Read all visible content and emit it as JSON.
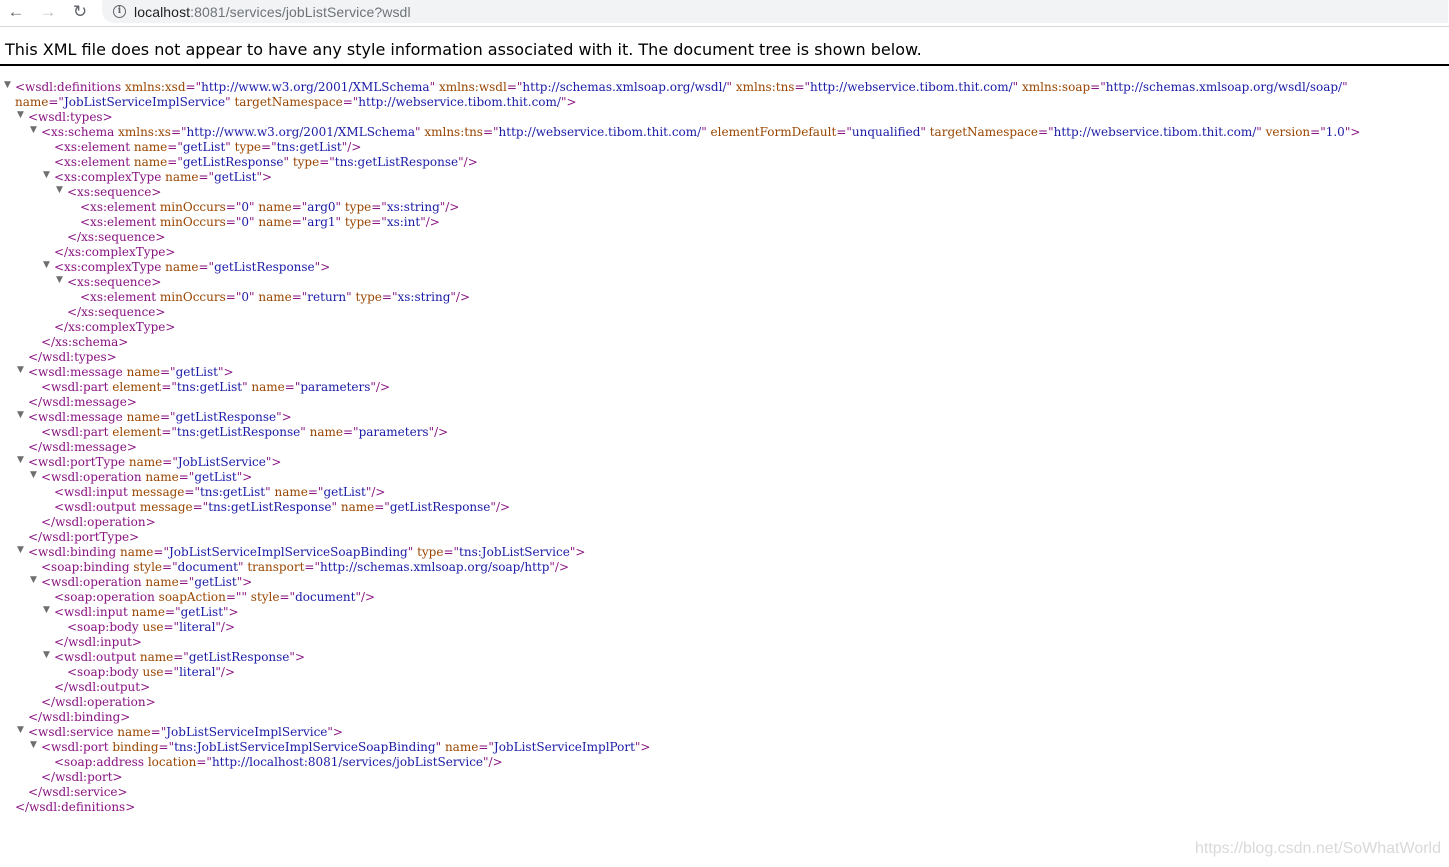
{
  "browser": {
    "url_host": "localhost",
    "url_rest": ":8081/services/jobListService?wsdl"
  },
  "banner": {
    "text": "This XML file does not appear to have any style information associated with it. The document tree is shown below."
  },
  "xml_lines": [
    {
      "indent": 0,
      "toggle": true,
      "parts": [
        [
          "t",
          "<wsdl:definitions "
        ],
        [
          "an",
          "xmlns:xsd"
        ],
        [
          "t",
          "=\""
        ],
        [
          "av",
          "http://www.w3.org/2001/XMLSchema"
        ],
        [
          "t",
          "\" "
        ],
        [
          "an",
          "xmlns:wsdl"
        ],
        [
          "t",
          "=\""
        ],
        [
          "av",
          "http://schemas.xmlsoap.org/wsdl/"
        ],
        [
          "t",
          "\" "
        ],
        [
          "an",
          "xmlns:tns"
        ],
        [
          "t",
          "=\""
        ],
        [
          "av",
          "http://webservice.tibom.thit.com/"
        ],
        [
          "t",
          "\" "
        ],
        [
          "an",
          "xmlns:soap"
        ],
        [
          "t",
          "=\""
        ],
        [
          "av",
          "http://schemas.xmlsoap.org/wsdl/soap/"
        ],
        [
          "t",
          "\""
        ]
      ]
    },
    {
      "indent": 0,
      "toggle": false,
      "parts": [
        [
          "an",
          "name"
        ],
        [
          "t",
          "=\""
        ],
        [
          "av",
          "JobListServiceImplService"
        ],
        [
          "t",
          "\" "
        ],
        [
          "an",
          "targetNamespace"
        ],
        [
          "t",
          "=\""
        ],
        [
          "av",
          "http://webservice.tibom.thit.com/"
        ],
        [
          "t",
          "\">"
        ]
      ]
    },
    {
      "indent": 1,
      "toggle": true,
      "parts": [
        [
          "t",
          "<wsdl:types>"
        ]
      ]
    },
    {
      "indent": 2,
      "toggle": true,
      "parts": [
        [
          "t",
          "<xs:schema "
        ],
        [
          "an",
          "xmlns:xs"
        ],
        [
          "t",
          "=\""
        ],
        [
          "av",
          "http://www.w3.org/2001/XMLSchema"
        ],
        [
          "t",
          "\" "
        ],
        [
          "an",
          "xmlns:tns"
        ],
        [
          "t",
          "=\""
        ],
        [
          "av",
          "http://webservice.tibom.thit.com/"
        ],
        [
          "t",
          "\" "
        ],
        [
          "an",
          "elementFormDefault"
        ],
        [
          "t",
          "=\""
        ],
        [
          "av",
          "unqualified"
        ],
        [
          "t",
          "\" "
        ],
        [
          "an",
          "targetNamespace"
        ],
        [
          "t",
          "=\""
        ],
        [
          "av",
          "http://webservice.tibom.thit.com/"
        ],
        [
          "t",
          "\" "
        ],
        [
          "an",
          "version"
        ],
        [
          "t",
          "=\""
        ],
        [
          "av",
          "1.0"
        ],
        [
          "t",
          "\">"
        ]
      ]
    },
    {
      "indent": 3,
      "toggle": false,
      "parts": [
        [
          "t",
          "<xs:element "
        ],
        [
          "an",
          "name"
        ],
        [
          "t",
          "=\""
        ],
        [
          "av",
          "getList"
        ],
        [
          "t",
          "\" "
        ],
        [
          "an",
          "type"
        ],
        [
          "t",
          "=\""
        ],
        [
          "av",
          "tns:getList"
        ],
        [
          "t",
          "\"/>"
        ]
      ]
    },
    {
      "indent": 3,
      "toggle": false,
      "parts": [
        [
          "t",
          "<xs:element "
        ],
        [
          "an",
          "name"
        ],
        [
          "t",
          "=\""
        ],
        [
          "av",
          "getListResponse"
        ],
        [
          "t",
          "\" "
        ],
        [
          "an",
          "type"
        ],
        [
          "t",
          "=\""
        ],
        [
          "av",
          "tns:getListResponse"
        ],
        [
          "t",
          "\"/>"
        ]
      ]
    },
    {
      "indent": 3,
      "toggle": true,
      "parts": [
        [
          "t",
          "<xs:complexType "
        ],
        [
          "an",
          "name"
        ],
        [
          "t",
          "=\""
        ],
        [
          "av",
          "getList"
        ],
        [
          "t",
          "\">"
        ]
      ]
    },
    {
      "indent": 4,
      "toggle": true,
      "parts": [
        [
          "t",
          "<xs:sequence>"
        ]
      ]
    },
    {
      "indent": 5,
      "toggle": false,
      "parts": [
        [
          "t",
          "<xs:element "
        ],
        [
          "an",
          "minOccurs"
        ],
        [
          "t",
          "=\""
        ],
        [
          "av",
          "0"
        ],
        [
          "t",
          "\" "
        ],
        [
          "an",
          "name"
        ],
        [
          "t",
          "=\""
        ],
        [
          "av",
          "arg0"
        ],
        [
          "t",
          "\" "
        ],
        [
          "an",
          "type"
        ],
        [
          "t",
          "=\""
        ],
        [
          "av",
          "xs:string"
        ],
        [
          "t",
          "\"/>"
        ]
      ]
    },
    {
      "indent": 5,
      "toggle": false,
      "parts": [
        [
          "t",
          "<xs:element "
        ],
        [
          "an",
          "minOccurs"
        ],
        [
          "t",
          "=\""
        ],
        [
          "av",
          "0"
        ],
        [
          "t",
          "\" "
        ],
        [
          "an",
          "name"
        ],
        [
          "t",
          "=\""
        ],
        [
          "av",
          "arg1"
        ],
        [
          "t",
          "\" "
        ],
        [
          "an",
          "type"
        ],
        [
          "t",
          "=\""
        ],
        [
          "av",
          "xs:int"
        ],
        [
          "t",
          "\"/>"
        ]
      ]
    },
    {
      "indent": 4,
      "toggle": false,
      "parts": [
        [
          "t",
          "</xs:sequence>"
        ]
      ]
    },
    {
      "indent": 3,
      "toggle": false,
      "parts": [
        [
          "t",
          "</xs:complexType>"
        ]
      ]
    },
    {
      "indent": 3,
      "toggle": true,
      "parts": [
        [
          "t",
          "<xs:complexType "
        ],
        [
          "an",
          "name"
        ],
        [
          "t",
          "=\""
        ],
        [
          "av",
          "getListResponse"
        ],
        [
          "t",
          "\">"
        ]
      ]
    },
    {
      "indent": 4,
      "toggle": true,
      "parts": [
        [
          "t",
          "<xs:sequence>"
        ]
      ]
    },
    {
      "indent": 5,
      "toggle": false,
      "parts": [
        [
          "t",
          "<xs:element "
        ],
        [
          "an",
          "minOccurs"
        ],
        [
          "t",
          "=\""
        ],
        [
          "av",
          "0"
        ],
        [
          "t",
          "\" "
        ],
        [
          "an",
          "name"
        ],
        [
          "t",
          "=\""
        ],
        [
          "av",
          "return"
        ],
        [
          "t",
          "\" "
        ],
        [
          "an",
          "type"
        ],
        [
          "t",
          "=\""
        ],
        [
          "av",
          "xs:string"
        ],
        [
          "t",
          "\"/>"
        ]
      ]
    },
    {
      "indent": 4,
      "toggle": false,
      "parts": [
        [
          "t",
          "</xs:sequence>"
        ]
      ]
    },
    {
      "indent": 3,
      "toggle": false,
      "parts": [
        [
          "t",
          "</xs:complexType>"
        ]
      ]
    },
    {
      "indent": 2,
      "toggle": false,
      "parts": [
        [
          "t",
          "</xs:schema>"
        ]
      ]
    },
    {
      "indent": 1,
      "toggle": false,
      "parts": [
        [
          "t",
          "</wsdl:types>"
        ]
      ]
    },
    {
      "indent": 1,
      "toggle": true,
      "parts": [
        [
          "t",
          "<wsdl:message "
        ],
        [
          "an",
          "name"
        ],
        [
          "t",
          "=\""
        ],
        [
          "av",
          "getList"
        ],
        [
          "t",
          "\">"
        ]
      ]
    },
    {
      "indent": 2,
      "toggle": false,
      "parts": [
        [
          "t",
          "<wsdl:part "
        ],
        [
          "an",
          "element"
        ],
        [
          "t",
          "=\""
        ],
        [
          "av",
          "tns:getList"
        ],
        [
          "t",
          "\" "
        ],
        [
          "an",
          "name"
        ],
        [
          "t",
          "=\""
        ],
        [
          "av",
          "parameters"
        ],
        [
          "t",
          "\"/>"
        ]
      ]
    },
    {
      "indent": 1,
      "toggle": false,
      "parts": [
        [
          "t",
          "</wsdl:message>"
        ]
      ]
    },
    {
      "indent": 1,
      "toggle": true,
      "parts": [
        [
          "t",
          "<wsdl:message "
        ],
        [
          "an",
          "name"
        ],
        [
          "t",
          "=\""
        ],
        [
          "av",
          "getListResponse"
        ],
        [
          "t",
          "\">"
        ]
      ]
    },
    {
      "indent": 2,
      "toggle": false,
      "parts": [
        [
          "t",
          "<wsdl:part "
        ],
        [
          "an",
          "element"
        ],
        [
          "t",
          "=\""
        ],
        [
          "av",
          "tns:getListResponse"
        ],
        [
          "t",
          "\" "
        ],
        [
          "an",
          "name"
        ],
        [
          "t",
          "=\""
        ],
        [
          "av",
          "parameters"
        ],
        [
          "t",
          "\"/>"
        ]
      ]
    },
    {
      "indent": 1,
      "toggle": false,
      "parts": [
        [
          "t",
          "</wsdl:message>"
        ]
      ]
    },
    {
      "indent": 1,
      "toggle": true,
      "parts": [
        [
          "t",
          "<wsdl:portType "
        ],
        [
          "an",
          "name"
        ],
        [
          "t",
          "=\""
        ],
        [
          "av",
          "JobListService"
        ],
        [
          "t",
          "\">"
        ]
      ]
    },
    {
      "indent": 2,
      "toggle": true,
      "parts": [
        [
          "t",
          "<wsdl:operation "
        ],
        [
          "an",
          "name"
        ],
        [
          "t",
          "=\""
        ],
        [
          "av",
          "getList"
        ],
        [
          "t",
          "\">"
        ]
      ]
    },
    {
      "indent": 3,
      "toggle": false,
      "parts": [
        [
          "t",
          "<wsdl:input "
        ],
        [
          "an",
          "message"
        ],
        [
          "t",
          "=\""
        ],
        [
          "av",
          "tns:getList"
        ],
        [
          "t",
          "\" "
        ],
        [
          "an",
          "name"
        ],
        [
          "t",
          "=\""
        ],
        [
          "av",
          "getList"
        ],
        [
          "t",
          "\"/>"
        ]
      ]
    },
    {
      "indent": 3,
      "toggle": false,
      "parts": [
        [
          "t",
          "<wsdl:output "
        ],
        [
          "an",
          "message"
        ],
        [
          "t",
          "=\""
        ],
        [
          "av",
          "tns:getListResponse"
        ],
        [
          "t",
          "\" "
        ],
        [
          "an",
          "name"
        ],
        [
          "t",
          "=\""
        ],
        [
          "av",
          "getListResponse"
        ],
        [
          "t",
          "\"/>"
        ]
      ]
    },
    {
      "indent": 2,
      "toggle": false,
      "parts": [
        [
          "t",
          "</wsdl:operation>"
        ]
      ]
    },
    {
      "indent": 1,
      "toggle": false,
      "parts": [
        [
          "t",
          "</wsdl:portType>"
        ]
      ]
    },
    {
      "indent": 1,
      "toggle": true,
      "parts": [
        [
          "t",
          "<wsdl:binding "
        ],
        [
          "an",
          "name"
        ],
        [
          "t",
          "=\""
        ],
        [
          "av",
          "JobListServiceImplServiceSoapBinding"
        ],
        [
          "t",
          "\" "
        ],
        [
          "an",
          "type"
        ],
        [
          "t",
          "=\""
        ],
        [
          "av",
          "tns:JobListService"
        ],
        [
          "t",
          "\">"
        ]
      ]
    },
    {
      "indent": 2,
      "toggle": false,
      "parts": [
        [
          "t",
          "<soap:binding "
        ],
        [
          "an",
          "style"
        ],
        [
          "t",
          "=\""
        ],
        [
          "av",
          "document"
        ],
        [
          "t",
          "\" "
        ],
        [
          "an",
          "transport"
        ],
        [
          "t",
          "=\""
        ],
        [
          "av",
          "http://schemas.xmlsoap.org/soap/http"
        ],
        [
          "t",
          "\"/>"
        ]
      ]
    },
    {
      "indent": 2,
      "toggle": true,
      "parts": [
        [
          "t",
          "<wsdl:operation "
        ],
        [
          "an",
          "name"
        ],
        [
          "t",
          "=\""
        ],
        [
          "av",
          "getList"
        ],
        [
          "t",
          "\">"
        ]
      ]
    },
    {
      "indent": 3,
      "toggle": false,
      "parts": [
        [
          "t",
          "<soap:operation "
        ],
        [
          "an",
          "soapAction"
        ],
        [
          "t",
          "=\"\" "
        ],
        [
          "an",
          "style"
        ],
        [
          "t",
          "=\""
        ],
        [
          "av",
          "document"
        ],
        [
          "t",
          "\"/>"
        ]
      ]
    },
    {
      "indent": 3,
      "toggle": true,
      "parts": [
        [
          "t",
          "<wsdl:input "
        ],
        [
          "an",
          "name"
        ],
        [
          "t",
          "=\""
        ],
        [
          "av",
          "getList"
        ],
        [
          "t",
          "\">"
        ]
      ]
    },
    {
      "indent": 4,
      "toggle": false,
      "parts": [
        [
          "t",
          "<soap:body "
        ],
        [
          "an",
          "use"
        ],
        [
          "t",
          "=\""
        ],
        [
          "av",
          "literal"
        ],
        [
          "t",
          "\"/>"
        ]
      ]
    },
    {
      "indent": 3,
      "toggle": false,
      "parts": [
        [
          "t",
          "</wsdl:input>"
        ]
      ]
    },
    {
      "indent": 3,
      "toggle": true,
      "parts": [
        [
          "t",
          "<wsdl:output "
        ],
        [
          "an",
          "name"
        ],
        [
          "t",
          "=\""
        ],
        [
          "av",
          "getListResponse"
        ],
        [
          "t",
          "\">"
        ]
      ]
    },
    {
      "indent": 4,
      "toggle": false,
      "parts": [
        [
          "t",
          "<soap:body "
        ],
        [
          "an",
          "use"
        ],
        [
          "t",
          "=\""
        ],
        [
          "av",
          "literal"
        ],
        [
          "t",
          "\"/>"
        ]
      ]
    },
    {
      "indent": 3,
      "toggle": false,
      "parts": [
        [
          "t",
          "</wsdl:output>"
        ]
      ]
    },
    {
      "indent": 2,
      "toggle": false,
      "parts": [
        [
          "t",
          "</wsdl:operation>"
        ]
      ]
    },
    {
      "indent": 1,
      "toggle": false,
      "parts": [
        [
          "t",
          "</wsdl:binding>"
        ]
      ]
    },
    {
      "indent": 1,
      "toggle": true,
      "parts": [
        [
          "t",
          "<wsdl:service "
        ],
        [
          "an",
          "name"
        ],
        [
          "t",
          "=\""
        ],
        [
          "av",
          "JobListServiceImplService"
        ],
        [
          "t",
          "\">"
        ]
      ]
    },
    {
      "indent": 2,
      "toggle": true,
      "parts": [
        [
          "t",
          "<wsdl:port "
        ],
        [
          "an",
          "binding"
        ],
        [
          "t",
          "=\""
        ],
        [
          "av",
          "tns:JobListServiceImplServiceSoapBinding"
        ],
        [
          "t",
          "\" "
        ],
        [
          "an",
          "name"
        ],
        [
          "t",
          "=\""
        ],
        [
          "av",
          "JobListServiceImplPort"
        ],
        [
          "t",
          "\">"
        ]
      ]
    },
    {
      "indent": 3,
      "toggle": false,
      "parts": [
        [
          "t",
          "<soap:address "
        ],
        [
          "an",
          "location"
        ],
        [
          "t",
          "=\""
        ],
        [
          "av",
          "http://localhost:8081/services/jobListService"
        ],
        [
          "t",
          "\"/>"
        ]
      ]
    },
    {
      "indent": 2,
      "toggle": false,
      "parts": [
        [
          "t",
          "</wsdl:port>"
        ]
      ]
    },
    {
      "indent": 1,
      "toggle": false,
      "parts": [
        [
          "t",
          "</wsdl:service>"
        ]
      ]
    },
    {
      "indent": 0,
      "toggle": false,
      "parts": [
        [
          "t",
          "</wsdl:definitions>"
        ]
      ]
    }
  ],
  "watermark": "https://blog.csdn.net/SoWhatWorld"
}
